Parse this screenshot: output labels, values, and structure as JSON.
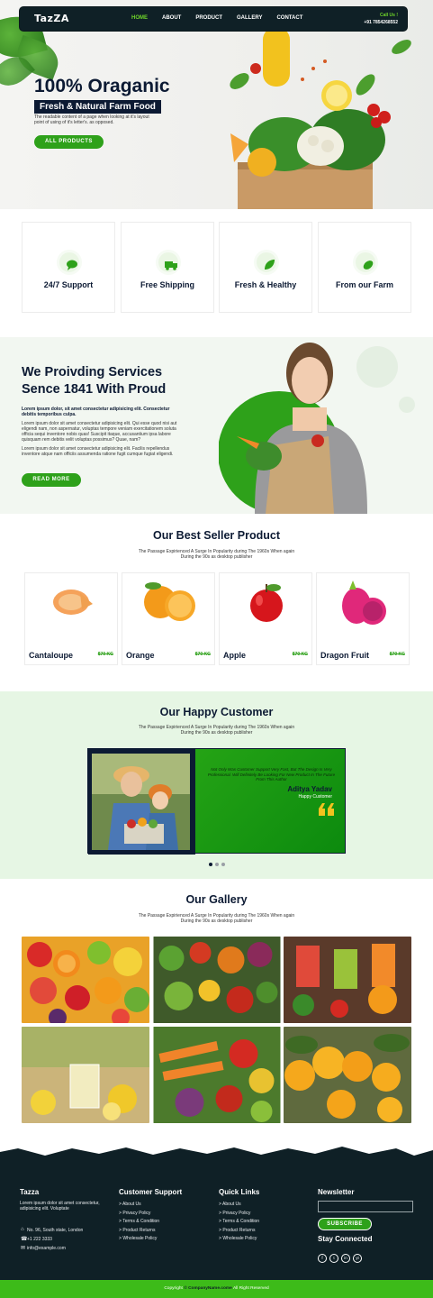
{
  "header": {
    "logo": "TazZA",
    "nav": [
      "HOME",
      "ABOUT",
      "PRODUCT",
      "GALLERY",
      "CONTACT"
    ],
    "call_label": "Call Us !",
    "phone": "+91 7854268552"
  },
  "hero": {
    "title": "100% Oraganic",
    "tagline": "Fresh & Natural Farm Food",
    "desc": "The readable content of a page when looking at it's layout point of using of it's letter's. as opposed.",
    "button": "ALL PRODUCTS"
  },
  "features": [
    {
      "label": "24/7 Support",
      "icon": "chat-icon"
    },
    {
      "label": "Free Shipping",
      "icon": "truck-icon"
    },
    {
      "label": "Fresh & Healthy",
      "icon": "leaf-icon"
    },
    {
      "label": "From our Farm",
      "icon": "farm-icon"
    }
  ],
  "about": {
    "title_line1": "We Proivding Services",
    "title_line2": "Sence 1841 With Proud",
    "p1": "Lorem ipsum dolor, sit amet consectetur adipisicing elit. Consectetur debitis temporibus culpa.",
    "p2": "Lorem ipsum dolor sit amet consectetur adipisicing elit. Qui esse quod nisi aut eligendi nam, non aspernatur, voluptas tempore veniam exercitationem soluta officia sequi inventore nobis quas! Suscipit itaque, accusantium ipsa labore quisquam rem debitis velit voluptas possimus? Quae, nam?",
    "p3": "Lorem ipsum dolor sit amet consectetur adipisicing elit. Facilis repellendus inventore atque nam officiis assumenda ratione fugit cumque fugiat eligendi.",
    "button": "READ MORE"
  },
  "best_seller": {
    "title": "Our Best Seller Product",
    "subtitle": "The Passage Expirienced A Surge In Popularity during The 1960s When again During the 90s as desktop publisher",
    "products": [
      {
        "name": "Cantaloupe",
        "price": "$70 KG"
      },
      {
        "name": "Orange",
        "price": "$70 KG"
      },
      {
        "name": "Apple",
        "price": "$70 KG"
      },
      {
        "name": "Dragon Fruit",
        "price": "$70 KG"
      }
    ]
  },
  "testimonials": {
    "title": "Our Happy Customer",
    "subtitle": "The Passage Expirienced A Surge In Popularity during The 1960s When again During the 90s as desktop publisher",
    "quote": "Not Only Was Customer Support Very Fast, But The Design Is Very Professional. Will Definitely Be Looking For New Product In The Future From This Author",
    "name": "Aditya Yadav",
    "role": "Happy Customer",
    "active_slide": 1,
    "slides": 3
  },
  "gallery": {
    "title": "Our Gallery",
    "subtitle": "The Passage Expirienced A Surge In Popularity during The 1960s When again During the 90s as desktop publisher"
  },
  "footer": {
    "brand": "Tazza",
    "brand_desc": "Lorem ipsum dolor sit amet consectetur, adipisicing elit. Voluptate",
    "address": "No. 96, South state, London",
    "phone": "+1 222 3333",
    "email": "info@example.com",
    "support_title": "Customer Support",
    "support_links": [
      "About Us",
      "Privacy Policy",
      "Terms & Condition",
      "Product Returns",
      "Wholesale Policy"
    ],
    "quick_title": "Quick Links",
    "quick_links": [
      "About Us",
      "Privacy Policy",
      "Terms & Condition",
      "Product Returns",
      "Wholesale Policy"
    ],
    "newsletter_title": "Newsletter",
    "subscribe": "SUBSCRIBE",
    "stay": "Stay Connected",
    "social": [
      "f",
      "t",
      "in",
      "yt"
    ],
    "copyright_pre": "Copyright",
    "copyright_name": "© CompanyName.come",
    "copyright_post": "All Right Reserved"
  },
  "colors": {
    "primary_green": "#2ea11a",
    "dark_navy": "#0c1a33",
    "footer_bg": "#0f2026",
    "copyright_bar": "#3dbb19"
  }
}
